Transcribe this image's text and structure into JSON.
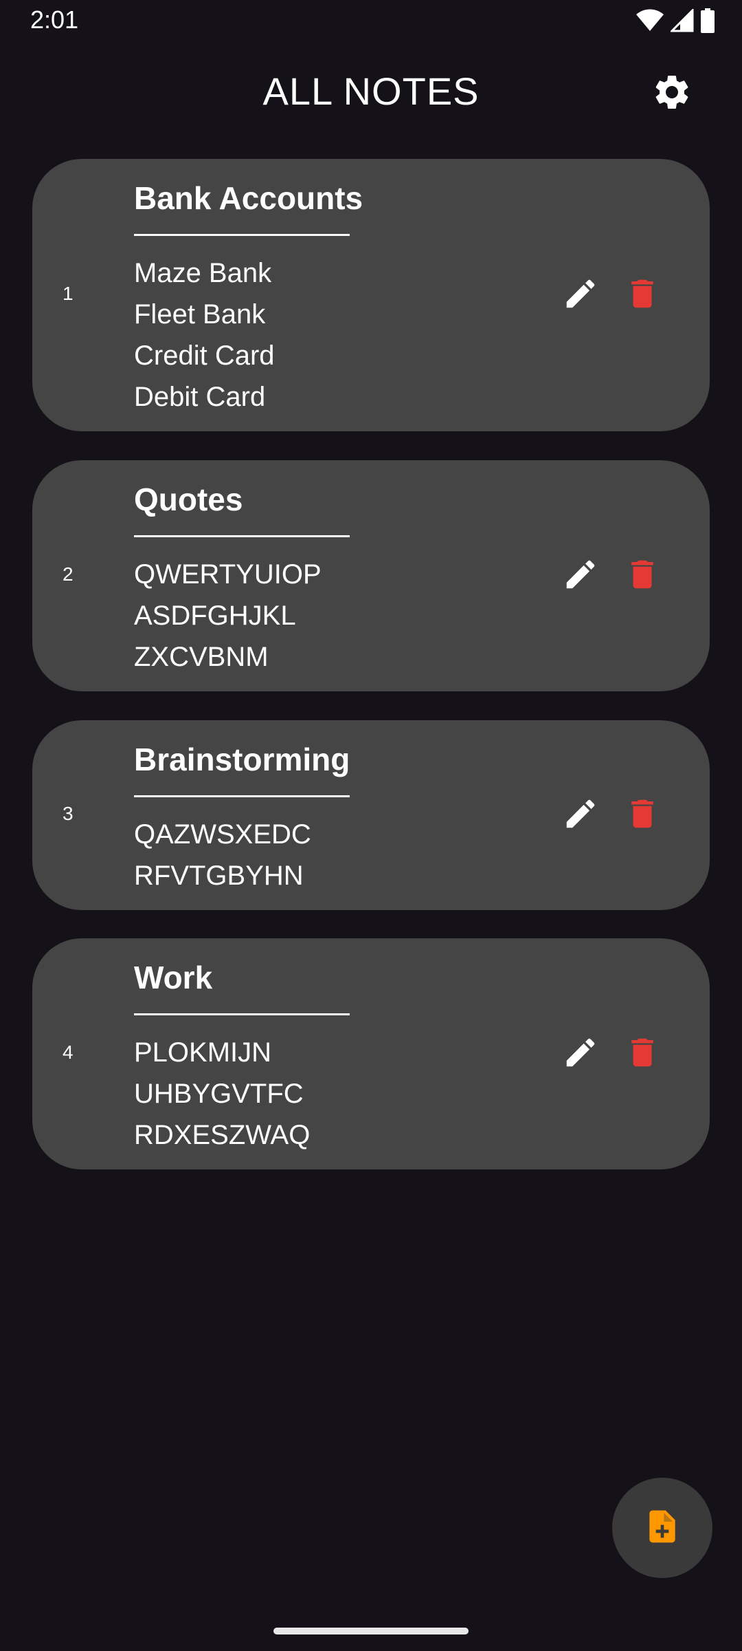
{
  "status_bar": {
    "time": "2:01",
    "icons": [
      "wifi-icon",
      "cellular-signal-icon",
      "battery-icon"
    ]
  },
  "header": {
    "title": "ALL NOTES",
    "settings_icon": "gear-icon"
  },
  "notes": [
    {
      "number": "1",
      "title": "Bank Accounts",
      "lines": [
        "Maze Bank",
        "Fleet Bank",
        "Credit Card",
        "Debit Card"
      ]
    },
    {
      "number": "2",
      "title": "Quotes",
      "lines": [
        "QWERTYUIOP",
        "ASDFGHJKL",
        "ZXCVBNM"
      ]
    },
    {
      "number": "3",
      "title": "Brainstorming",
      "lines": [
        "QAZWSXEDC",
        "RFVTGBYHN"
      ]
    },
    {
      "number": "4",
      "title": "Work",
      "lines": [
        "PLOKMIJN",
        "UHBYGVTFC",
        "RDXESZWAQ"
      ]
    }
  ],
  "actions": {
    "edit_icon": "pencil-icon",
    "delete_icon": "trash-icon",
    "add_note_icon": "add-note-icon"
  },
  "colors": {
    "background": "#141218",
    "card": "#454545",
    "delete": "#e53935",
    "fab_icon": "#ff9800",
    "fab_background": "#3a3a3a"
  }
}
